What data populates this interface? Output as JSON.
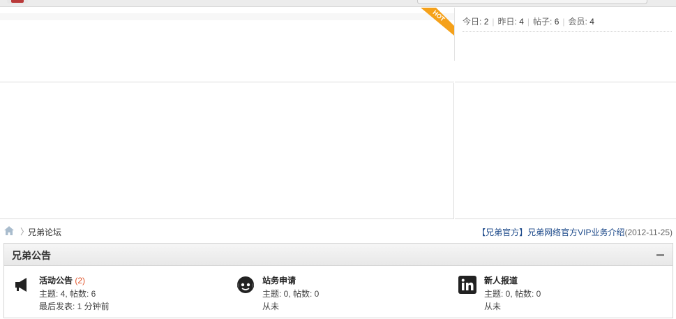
{
  "badges": {
    "hot": "HOT"
  },
  "stats": [
    {
      "label": "今日:",
      "value": "2"
    },
    {
      "label": "昨日:",
      "value": "4"
    },
    {
      "label": "帖子:",
      "value": "6"
    },
    {
      "label": "会员:",
      "value": "4"
    }
  ],
  "breadcrumb": {
    "separator": "〉",
    "current": "兄弟论坛"
  },
  "notice": {
    "link_text": "【兄弟官方】兄弟网络官方VIP业务介绍",
    "date": "(2012-11-25)"
  },
  "category": {
    "title": "兄弟公告",
    "forums": [
      {
        "name": "活动公告",
        "count": "(2)",
        "stats": "主题: 4, 帖数: 6",
        "last": "最后发表: 1 分钟前",
        "icon": "megaphone-icon"
      },
      {
        "name": "站务申请",
        "count": "",
        "stats": "主题: 0, 帖数: 0",
        "last": "从未",
        "icon": "support-agent-icon"
      },
      {
        "name": "新人报道",
        "count": "",
        "stats": "主题: 0, 帖数: 0",
        "last": "从未",
        "icon": "linkedin-icon"
      }
    ]
  },
  "colors": {
    "hot_ribbon": "#f5a11a",
    "link": "#1d4a8a",
    "count": "#e0552b"
  }
}
